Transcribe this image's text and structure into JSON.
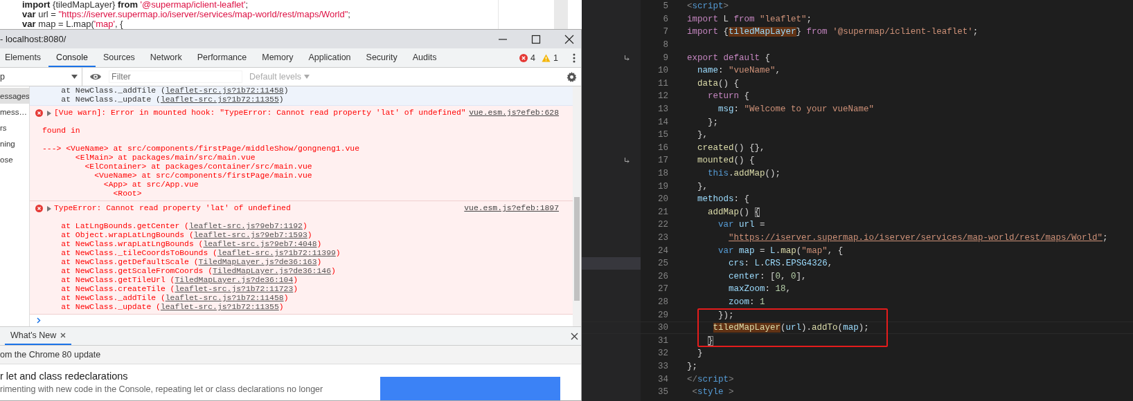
{
  "background_page": {
    "lines": [
      [
        {
          "text": "import",
          "kind": "kw"
        },
        {
          "text": " {tiledMapLayer}",
          "kind": "plain"
        },
        {
          "text": " from",
          "kind": "kw"
        },
        {
          "text": " '@supermap/iclient-leaflet'",
          "kind": "str"
        },
        {
          "text": ";",
          "kind": "plain"
        }
      ],
      [
        {
          "text": "var",
          "kind": "kw"
        },
        {
          "text": " url =",
          "kind": "plain"
        },
        {
          "text": " \"https://iserver.supermap.io/iserver/services/map-world/rest/maps/World\"",
          "kind": "str"
        },
        {
          "text": ";",
          "kind": "plain"
        }
      ],
      [
        {
          "text": "var",
          "kind": "kw"
        },
        {
          "text": " map = L.map(",
          "kind": "plain"
        },
        {
          "text": "'map'",
          "kind": "str"
        },
        {
          "text": ", {",
          "kind": "plain"
        }
      ]
    ]
  },
  "devtools": {
    "title": "- localhost:8080/",
    "tabs": [
      {
        "label": "Elements",
        "selected": false
      },
      {
        "label": "Console",
        "selected": true
      },
      {
        "label": "Sources",
        "selected": false
      },
      {
        "label": "Network",
        "selected": false
      },
      {
        "label": "Performance",
        "selected": false
      },
      {
        "label": "Memory",
        "selected": false
      },
      {
        "label": "Application",
        "selected": false
      },
      {
        "label": "Security",
        "selected": false
      },
      {
        "label": "Audits",
        "selected": false
      }
    ],
    "error_count": "4",
    "warning_count": "1",
    "context_selector": "p",
    "filter": {
      "placeholder": "Filter"
    },
    "levels": "Default levels",
    "sidebar": {
      "items": [
        {
          "label": "essages",
          "selected": true
        },
        {
          "label": "mess…",
          "selected": false
        },
        {
          "label": "rs",
          "selected": false
        },
        {
          "label": "ning",
          "selected": false
        },
        {
          "label": "ose",
          "selected": false
        }
      ]
    },
    "console": {
      "entries": [
        {
          "kind": "info",
          "paragraphs": [
            [
              {
                "prefix": "    at NewClass._addTile (",
                "link": "leaflet-src.js?1b72:11458",
                "suffix": ")"
              },
              {
                "prefix": "    at NewClass._update (",
                "link": "leaflet-src.js?1b72:11355",
                "suffix": ")"
              }
            ]
          ]
        },
        {
          "kind": "error",
          "message": "[Vue warn]: Error in mounted hook: \"TypeError: Cannot read property 'lat' of undefined\"",
          "source": "vue.esm.js?efeb:628",
          "paragraphs": [
            [
              {
                "prefix": "found in"
              }
            ],
            [
              {
                "prefix": "---> <VueName> at src/components/firstPage/middleShow/gongneng1.vue"
              },
              {
                "prefix": "       <ElMain> at packages/main/src/main.vue"
              },
              {
                "prefix": "         <ElContainer> at packages/container/src/main.vue"
              },
              {
                "prefix": "           <VueName> at src/components/firstPage/main.vue"
              },
              {
                "prefix": "             <App> at src/App.vue"
              },
              {
                "prefix": "               <Root>"
              }
            ]
          ]
        },
        {
          "kind": "error",
          "message": "TypeError: Cannot read property 'lat' of undefined",
          "source": "vue.esm.js?efeb:1897",
          "paragraphs": [
            [
              {
                "prefix": "    at LatLngBounds.getCenter (",
                "link": "leaflet-src.js?9eb7:1192",
                "suffix": ")"
              },
              {
                "prefix": "    at Object.wrapLatLngBounds (",
                "link": "leaflet-src.js?9eb7:1593",
                "suffix": ")"
              },
              {
                "prefix": "    at NewClass.wrapLatLngBounds (",
                "link": "leaflet-src.js?9eb7:4048",
                "suffix": ")"
              },
              {
                "prefix": "    at NewClass._tileCoordsToBounds (",
                "link": "leaflet-src.js?1b72:11399",
                "suffix": ")"
              },
              {
                "prefix": "    at NewClass.getDefaultScale (",
                "link": "TiledMapLayer.js?de36:163",
                "suffix": ")"
              },
              {
                "prefix": "    at NewClass.getScaleFromCoords (",
                "link": "TiledMapLayer.js?de36:146",
                "suffix": ")"
              },
              {
                "prefix": "    at NewClass.getTileUrl (",
                "link": "TiledMapLayer.js?de36:104",
                "suffix": ")"
              },
              {
                "prefix": "    at NewClass.createTile (",
                "link": "leaflet-src.js?1b72:11723",
                "suffix": ")"
              },
              {
                "prefix": "    at NewClass._addTile (",
                "link": "leaflet-src.js?1b72:11458",
                "suffix": ")"
              },
              {
                "prefix": "    at NewClass._update (",
                "link": "leaflet-src.js?1b72:11355",
                "suffix": ")"
              }
            ]
          ]
        }
      ]
    },
    "drawer": {
      "tabs": [
        {
          "label": "What's New",
          "selected": true
        }
      ],
      "subtitle": "om the Chrome 80 update",
      "heading": "r let and class redeclarations",
      "text": "rimenting with new code in the Console, repeating let or class declarations no longer"
    }
  },
  "editor": {
    "lines": [
      {
        "number": "5",
        "tokens": [
          {
            "text": "<",
            "kind": "tag"
          },
          {
            "text": "script",
            "kind": "tagname"
          },
          {
            "text": ">",
            "kind": "tag"
          }
        ]
      },
      {
        "number": "6",
        "tokens": [
          {
            "text": "import",
            "kind": "kw"
          },
          {
            "text": " L",
            "kind": "plain"
          },
          {
            "text": " from",
            "kind": "kw"
          },
          {
            "text": " \"leaflet\"",
            "kind": "str"
          },
          {
            "text": ";",
            "kind": "plain"
          }
        ]
      },
      {
        "number": "7",
        "tokens": [
          {
            "text": "import",
            "kind": "kw"
          },
          {
            "text": " {",
            "kind": "plain"
          },
          {
            "text": "tiledMapLayer",
            "kind": "var",
            "match_highlight": true
          },
          {
            "text": "}",
            "kind": "plain"
          },
          {
            "text": " from",
            "kind": "kw"
          },
          {
            "text": " '@supermap/iclient-leaflet'",
            "kind": "str"
          },
          {
            "text": ";",
            "kind": "plain"
          }
        ]
      },
      {
        "number": "8"
      },
      {
        "number": "9",
        "gutter_marker": true,
        "tokens": [
          {
            "text": "export",
            "kind": "kw"
          },
          {
            "text": " default",
            "kind": "kw"
          },
          {
            "text": " {",
            "kind": "plain"
          }
        ]
      },
      {
        "number": "10",
        "tokens": [
          {
            "text": "  name",
            "kind": "var"
          },
          {
            "text": ":",
            "kind": "plain"
          },
          {
            "text": " \"vueName\"",
            "kind": "str"
          },
          {
            "text": ",",
            "kind": "plain"
          }
        ]
      },
      {
        "number": "11",
        "tokens": [
          {
            "text": "  data",
            "kind": "fn"
          },
          {
            "text": "() {",
            "kind": "plain"
          }
        ]
      },
      {
        "number": "12",
        "tokens": [
          {
            "text": "    return",
            "kind": "kw"
          },
          {
            "text": " {",
            "kind": "plain"
          }
        ]
      },
      {
        "number": "13",
        "tokens": [
          {
            "text": "      msg",
            "kind": "var"
          },
          {
            "text": ":",
            "kind": "plain"
          },
          {
            "text": " \"Welcome to your vueName\"",
            "kind": "str"
          }
        ]
      },
      {
        "number": "14",
        "tokens": [
          {
            "text": "    };",
            "kind": "plain"
          }
        ]
      },
      {
        "number": "15",
        "tokens": [
          {
            "text": "  },",
            "kind": "plain"
          }
        ]
      },
      {
        "number": "16",
        "tokens": [
          {
            "text": "  created",
            "kind": "fn"
          },
          {
            "text": "() {},",
            "kind": "plain"
          }
        ]
      },
      {
        "number": "17",
        "gutter_marker": true,
        "tokens": [
          {
            "text": "  mounted",
            "kind": "fn"
          },
          {
            "text": "() {",
            "kind": "plain"
          }
        ]
      },
      {
        "number": "18",
        "tokens": [
          {
            "text": "    this",
            "kind": "decl"
          },
          {
            "text": ".",
            "kind": "plain"
          },
          {
            "text": "addMap",
            "kind": "fn"
          },
          {
            "text": "();",
            "kind": "plain"
          }
        ]
      },
      {
        "number": "19",
        "tokens": [
          {
            "text": "  },",
            "kind": "plain"
          }
        ]
      },
      {
        "number": "20",
        "tokens": [
          {
            "text": "  methods",
            "kind": "var"
          },
          {
            "text": ": {",
            "kind": "plain"
          }
        ]
      },
      {
        "number": "21",
        "tokens": [
          {
            "text": "    addMap",
            "kind": "fn"
          },
          {
            "text": "()",
            "kind": "plain"
          },
          {
            "text": " {",
            "kind": "plain",
            "bracket_highlight": true
          }
        ]
      },
      {
        "number": "22",
        "tokens": [
          {
            "text": "      var",
            "kind": "decl"
          },
          {
            "text": " url",
            "kind": "var"
          },
          {
            "text": " =",
            "kind": "plain"
          }
        ]
      },
      {
        "number": "23",
        "tokens": [
          {
            "text": "        \"https://iserver.supermap.io/iserver/services/map-world/rest/maps/World\"",
            "kind": "link"
          },
          {
            "text": ";",
            "kind": "plain"
          }
        ]
      },
      {
        "number": "24",
        "tokens": [
          {
            "text": "      var",
            "kind": "decl"
          },
          {
            "text": " map",
            "kind": "var"
          },
          {
            "text": " =",
            "kind": "plain"
          },
          {
            "text": " L",
            "kind": "var"
          },
          {
            "text": ".",
            "kind": "plain"
          },
          {
            "text": "map",
            "kind": "fn"
          },
          {
            "text": "(",
            "kind": "plain"
          },
          {
            "text": "\"map\"",
            "kind": "str"
          },
          {
            "text": ", {",
            "kind": "plain"
          }
        ]
      },
      {
        "number": "25",
        "gutter_highlight": true,
        "tokens": [
          {
            "text": "        crs",
            "kind": "var"
          },
          {
            "text": ":",
            "kind": "plain"
          },
          {
            "text": " L",
            "kind": "var"
          },
          {
            "text": ".",
            "kind": "plain"
          },
          {
            "text": "CRS",
            "kind": "var"
          },
          {
            "text": ".",
            "kind": "plain"
          },
          {
            "text": "EPSG4326",
            "kind": "var"
          },
          {
            "text": ",",
            "kind": "plain"
          }
        ]
      },
      {
        "number": "26",
        "tokens": [
          {
            "text": "        center",
            "kind": "var"
          },
          {
            "text": ": [",
            "kind": "plain"
          },
          {
            "text": "0",
            "kind": "num"
          },
          {
            "text": ",",
            "kind": "plain"
          },
          {
            "text": " 0",
            "kind": "num"
          },
          {
            "text": "],",
            "kind": "plain"
          }
        ]
      },
      {
        "number": "27",
        "tokens": [
          {
            "text": "        maxZoom",
            "kind": "var"
          },
          {
            "text": ":",
            "kind": "plain"
          },
          {
            "text": " 18",
            "kind": "num"
          },
          {
            "text": ",",
            "kind": "plain"
          }
        ]
      },
      {
        "number": "28",
        "tokens": [
          {
            "text": "        zoom",
            "kind": "var"
          },
          {
            "text": ":",
            "kind": "plain"
          },
          {
            "text": " 1",
            "kind": "num"
          }
        ]
      },
      {
        "number": "29",
        "boxed": true,
        "tokens": [
          {
            "text": "      });",
            "kind": "plain"
          }
        ]
      },
      {
        "number": "30",
        "boxed": true,
        "active": true,
        "tokens": [
          {
            "text": "     tiledMapLayer",
            "kind": "fn",
            "match_highlight": true
          },
          {
            "text": "(",
            "kind": "plain"
          },
          {
            "text": "url",
            "kind": "var"
          },
          {
            "text": ").",
            "kind": "plain"
          },
          {
            "text": "addTo",
            "kind": "fn"
          },
          {
            "text": "(",
            "kind": "plain"
          },
          {
            "text": "map",
            "kind": "var"
          },
          {
            "text": ");",
            "kind": "plain"
          }
        ]
      },
      {
        "number": "31",
        "boxed": true,
        "tokens": [
          {
            "text": "    }",
            "kind": "plain",
            "bracket_highlight": true
          }
        ]
      },
      {
        "number": "32",
        "tokens": [
          {
            "text": "  }",
            "kind": "plain"
          }
        ]
      },
      {
        "number": "33",
        "tokens": [
          {
            "text": "};",
            "kind": "plain"
          }
        ]
      },
      {
        "number": "34",
        "tokens": [
          {
            "text": "</",
            "kind": "tag"
          },
          {
            "text": "script",
            "kind": "tagname"
          },
          {
            "text": ">",
            "kind": "tag"
          }
        ]
      },
      {
        "number": "35",
        "tokens": [
          {
            "text": " <",
            "kind": "tag"
          },
          {
            "text": "style",
            "kind": "tagname"
          },
          {
            "text": " >",
            "kind": "tag"
          }
        ]
      }
    ]
  }
}
